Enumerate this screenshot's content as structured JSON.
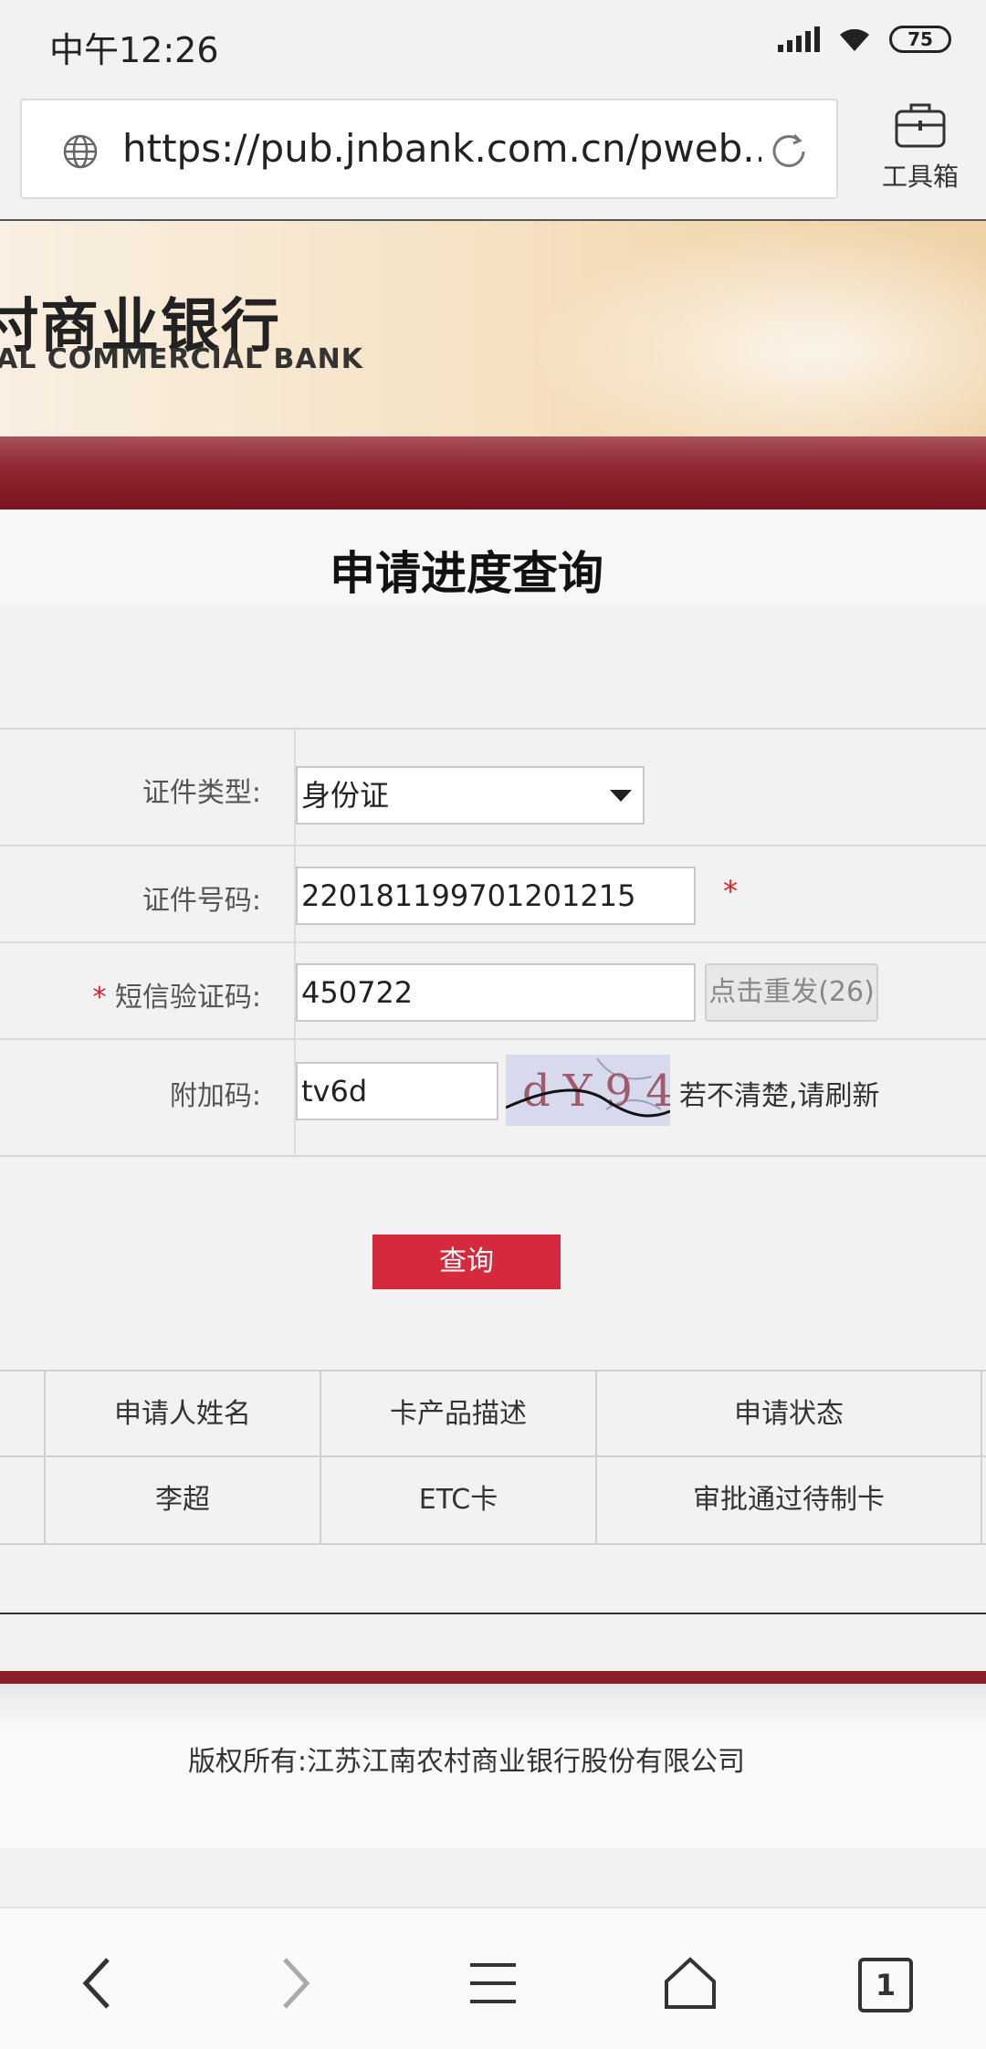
{
  "status_bar": {
    "time": "中午12:26",
    "battery": "75"
  },
  "browser": {
    "url": "https://pub.jnbank.com.cn/pweb...",
    "toolbox_label": "工具箱",
    "tab_count": "1"
  },
  "banner": {
    "cn_name": "村商业银行",
    "en_name": "AL COMMERCIAL BANK"
  },
  "page": {
    "title": "申请进度查询"
  },
  "form": {
    "id_type_label": "证件类型:",
    "id_type_value": "身份证",
    "id_number_label": "证件号码:",
    "id_number_value": "220181199701201215",
    "required_star": "*",
    "sms_label": "短信验证码:",
    "sms_value": "450722",
    "resend_label": "点击重发(26)",
    "extra_label": "附加码:",
    "extra_value": "tv6d",
    "captcha_text": "dY94",
    "refresh_hint": "若不清楚,请刷新",
    "query_button": "查询"
  },
  "results": {
    "headers": [
      "申请人姓名",
      "卡产品描述",
      "申请状态"
    ],
    "rows": [
      [
        "李超",
        "ETC卡",
        "审批通过待制卡"
      ]
    ]
  },
  "footer": {
    "copyright": "版权所有:江苏江南农村商业银行股份有限公司"
  }
}
